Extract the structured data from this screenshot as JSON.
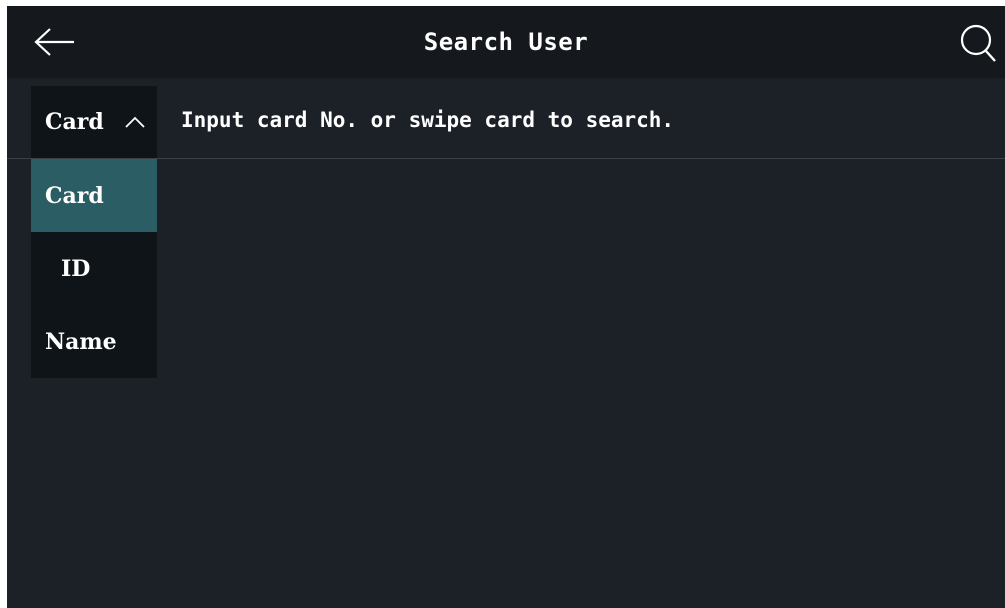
{
  "header": {
    "title": "Search User",
    "back_icon": "arrow-left-icon",
    "search_icon": "search-icon"
  },
  "search": {
    "type_selected": "Card",
    "placeholder": "Input card No. or swipe card to search.",
    "value": ""
  },
  "dropdown": {
    "options": [
      "Card",
      "ID",
      "Name"
    ],
    "selected_index": 0
  },
  "colors": {
    "background": "#1c2128",
    "header_bg": "#15191e",
    "dropdown_bg": "#0f1418",
    "selected_bg": "#2a5e64",
    "text": "#ffffff"
  }
}
